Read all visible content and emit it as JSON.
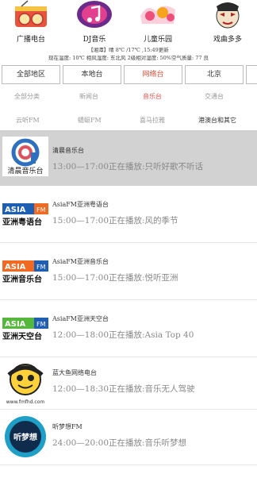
{
  "categories": [
    {
      "label": "广播电台",
      "icon": "radio-icon"
    },
    {
      "label": "DJ音乐",
      "icon": "dj-music-icon"
    },
    {
      "label": "儿童乐园",
      "icon": "kids-icon"
    },
    {
      "label": "戏曲多多",
      "icon": "opera-mask-icon"
    }
  ],
  "weather": {
    "line1": "【湘潭】晴 8℃ /17℃ ,15:49更新",
    "line2": "现在温度: 10℃  相风湿度: 东北风 2级相对湿度: 50%空气质量: 77 良"
  },
  "region_tabs": [
    "全部地区",
    "本地台",
    "网络台",
    "北京"
  ],
  "region_active": "网络台",
  "genres_row1": [
    "全部分类",
    "新闻台",
    "音乐台",
    "交通台"
  ],
  "genres_row2": [
    "云听FM",
    "蜻蜓FM",
    "喜马拉雅",
    "港澳台和其它"
  ],
  "genre_active": "音乐台",
  "stations": [
    {
      "name": "清晨音乐台",
      "now": "13:00—17:00正在播放:只听好歌不听话",
      "logo_text": "清晨音乐台",
      "logo_type": "qingchen"
    },
    {
      "name": "AsiaFM亚洲粤语台",
      "now": "15:00—17:00正在播放:风的季节",
      "logo_text": "亚洲粤语台",
      "logo_type": "asia"
    },
    {
      "name": "AsiaFM亚洲音乐台",
      "now": "15:00—17:00正在播放:悦听亚洲",
      "logo_text": "亚洲音乐台",
      "logo_type": "asia"
    },
    {
      "name": "AsiaFM亚洲天空台",
      "now": "12:00—18:00正在播放:Asia Top 40",
      "logo_text": "亚洲天空台",
      "logo_type": "asia-green"
    },
    {
      "name": "蓝大鱼网络电台",
      "now": "12:00—18:30正在播放:音乐无人驾驶",
      "logo_text": "www.fmfhd.com",
      "logo_type": "fish"
    },
    {
      "name": "听梦想FM",
      "now": "24:00—20:00正在播放:音乐听梦想",
      "logo_text": "听梦想",
      "logo_type": "dream"
    }
  ],
  "asia_badge": "ASIA",
  "asia_badge_sub": "FM",
  "colors": {
    "highlight": "#d2d2d2",
    "accent": "#e05050",
    "asia_orange": "#f26a21",
    "asia_blue": "#1e5fb3",
    "asia_green": "#55b83c"
  }
}
